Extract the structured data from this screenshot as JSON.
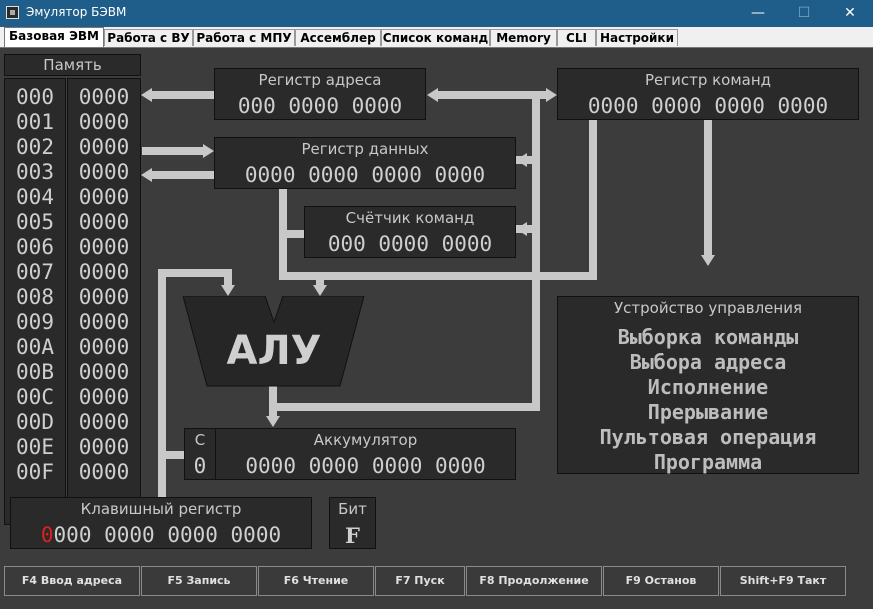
{
  "window": {
    "title": "Эмулятор БЭВМ",
    "minimize": "—",
    "maximize": "☐",
    "close": "✕"
  },
  "tabs": [
    "Базовая ЭВМ",
    "Работа с ВУ",
    "Работа с МПУ",
    "Ассемблер",
    "Список команд",
    "Memory",
    "CLI",
    "Настройки"
  ],
  "memory": {
    "title": "Память",
    "addresses": [
      "000",
      "001",
      "002",
      "003",
      "004",
      "005",
      "006",
      "007",
      "008",
      "009",
      "00A",
      "00B",
      "00C",
      "00D",
      "00E",
      "00F"
    ],
    "values": [
      "0000",
      "0000",
      "0000",
      "0000",
      "0000",
      "0000",
      "0000",
      "0000",
      "0000",
      "0000",
      "0000",
      "0000",
      "0000",
      "0000",
      "0000",
      "0000"
    ]
  },
  "registers": {
    "address": {
      "title": "Регистр адреса",
      "value": "000 0000 0000"
    },
    "command": {
      "title": "Регистр команд",
      "value": "0000 0000 0000 0000"
    },
    "data": {
      "title": "Регистр данных",
      "value": "0000 0000 0000 0000"
    },
    "counter": {
      "title": "Счётчик команд",
      "value": "000 0000 0000"
    },
    "accumulator": {
      "title": "Аккумулятор",
      "value": "0000 0000 0000 0000",
      "c_label": "C",
      "c_value": "0"
    },
    "keyboard": {
      "title": "Клавишный регистр",
      "first_digit": "0",
      "rest": "000 0000 0000 0000"
    },
    "bit": {
      "title": "Бит",
      "value": "F"
    }
  },
  "alu": {
    "label": "АЛУ"
  },
  "control_unit": {
    "title": "Устройство управления",
    "lines": [
      "Выборка команды",
      "Выбора адреса",
      "Исполнение",
      "Прерывание",
      "Пультовая операция",
      "Программа"
    ]
  },
  "buttons": [
    "F4 Ввод адреса",
    "F5 Запись",
    "F6 Чтение",
    "F7 Пуск",
    "F8 Продолжение",
    "F9 Останов",
    "Shift+F9 Такт"
  ],
  "colors": {
    "background": "#3c3c3c",
    "box": "#2a2a2a",
    "text": "#cfcfcf",
    "highlight": "#e02020",
    "titlebar": "#1f5d8a"
  }
}
